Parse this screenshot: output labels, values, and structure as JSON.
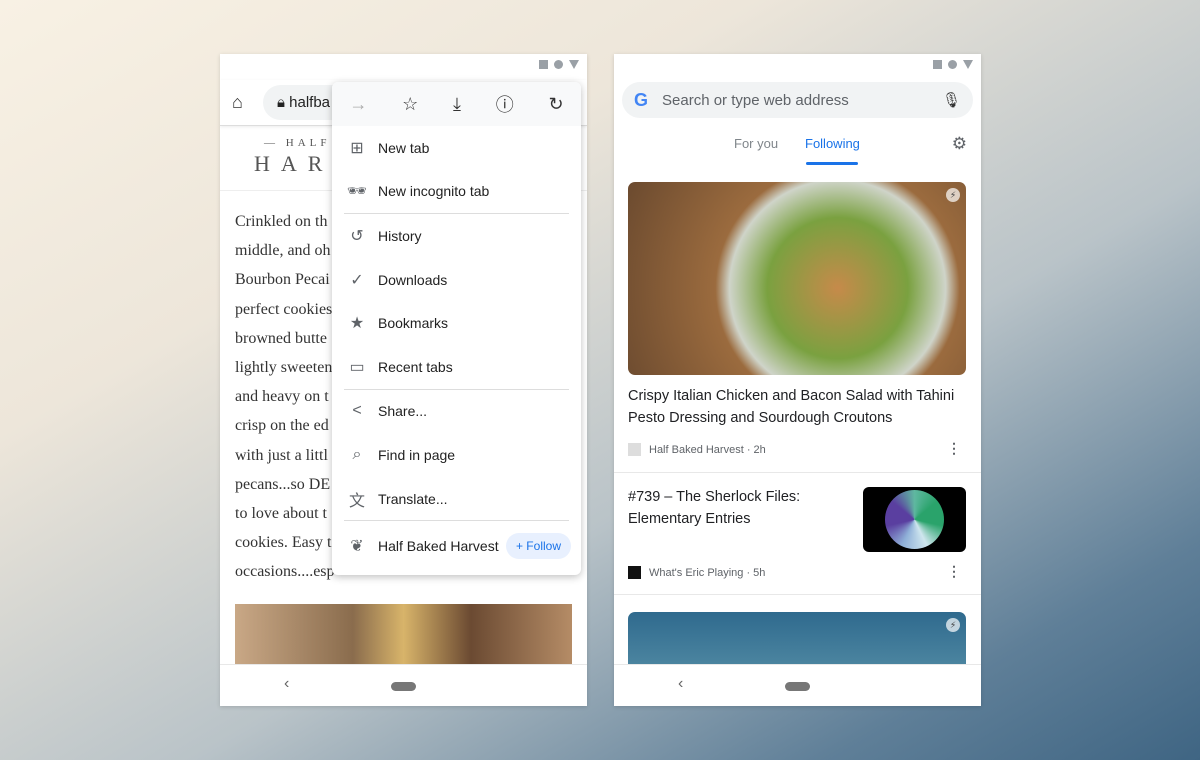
{
  "left": {
    "url": "halfba",
    "logo": {
      "small": "— HALF",
      "big": "HAR"
    },
    "article_lines": [
      "Crinkled on th",
      "middle, and oh",
      "Bourbon Pecai",
      "perfect cookies",
      "browned butte",
      "lightly sweeten",
      "and heavy on t",
      "crisp on the ed",
      "with just a littl",
      "pecans...so DE",
      "to love about t",
      "cookies. Easy t",
      "occasions....esp"
    ],
    "menu": {
      "top_icons": [
        "forward-icon",
        "star-icon",
        "download-icon",
        "info-icon",
        "reload-icon"
      ],
      "items": [
        {
          "label": "New tab",
          "icon": "new-tab-icon"
        },
        {
          "label": "New incognito tab",
          "icon": "incognito-icon"
        },
        {
          "label": "History",
          "icon": "history-icon"
        },
        {
          "label": "Downloads",
          "icon": "downloads-icon"
        },
        {
          "label": "Bookmarks",
          "icon": "bookmarks-icon"
        },
        {
          "label": "Recent tabs",
          "icon": "recent-tabs-icon"
        },
        {
          "label": "Share...",
          "icon": "share-icon"
        },
        {
          "label": "Find in page",
          "icon": "find-icon"
        },
        {
          "label": "Translate...",
          "icon": "translate-icon"
        }
      ],
      "site": "Half Baked Harvest",
      "follow": "+ Follow"
    }
  },
  "right": {
    "search_placeholder": "Search or type web address",
    "tabs": [
      "For you",
      "Following"
    ],
    "active_tab": "Following",
    "accent": "#1a73e8",
    "cards": [
      {
        "title": "Crispy Italian Chicken and Bacon Salad with Tahini Pesto Dressing and Sourdough Croutons",
        "source": "Half Baked Harvest · 2h"
      },
      {
        "title": "#739 – The Sherlock Files: Elementary Entries",
        "source": "What's Eric Playing · 5h"
      }
    ]
  }
}
